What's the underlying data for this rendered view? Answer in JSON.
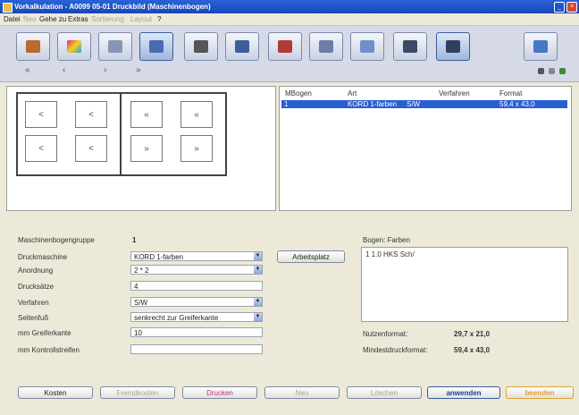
{
  "window": {
    "title": "Vorkalkulation - A0099 05-01 Druckbild (Maschinenbogen)"
  },
  "menu": {
    "items": [
      "Datei",
      "Neu",
      "Gehe zu",
      "Extras",
      "Sortierung",
      "Layout",
      "?"
    ]
  },
  "toolbar": {
    "nav": [
      "«",
      "‹",
      "›",
      "»"
    ]
  },
  "preview": {
    "cells": [
      "<",
      "<",
      "<",
      "<",
      "«",
      "«",
      "»",
      "»"
    ]
  },
  "grid": {
    "headers": [
      "MBogen",
      "Art",
      "Verfahren",
      "Format"
    ],
    "rows": [
      {
        "mbogen": "1",
        "art": "KORD 1-farben",
        "verfahren": "S/W",
        "format": "59,4 x 43,0"
      }
    ]
  },
  "form": {
    "maschinenbogengruppe_label": "Maschinenbogengruppe",
    "maschinenbogengruppe_value": "1",
    "druckmaschine_label": "Druckmaschine",
    "druckmaschine_value": "KORD 1-farben",
    "anordnung_label": "Anordnung",
    "anordnung_value": "2 * 2",
    "drucksaetze_label": "Drucksätze",
    "drucksaetze_value": "4",
    "verfahren_label": "Verfahren",
    "verfahren_value": "S/W",
    "seitenfuss_label": "Seitenfuß",
    "seitenfuss_value": "senkrecht zur Greiferkante",
    "greiferkante_label": "mm Greiferkante",
    "greiferkante_value": "10",
    "kontrollstreifen_label": "mm Kontrollstreifen",
    "kontrollstreifen_value": "",
    "arbeitsplatz_button": "Arbeitsplatz"
  },
  "right": {
    "bogen_farben_label": "Bogen: Farben",
    "farben_line": "1    1.0  HKS Sch/",
    "nutzenformat_label": "Nutzenformat:",
    "nutzenformat_value": "29,7 x 21,0",
    "mindestdruckformat_label": "Mindestdruckformat:",
    "mindestdruckformat_value": "59,4 x 43,0"
  },
  "buttons": {
    "kosten": "Kosten",
    "fremdkosten": "Fremdkosten",
    "drucken": "Drucken",
    "neu": "Neu",
    "loeschen": "Löschen",
    "anwenden": "anwenden",
    "beenden": "beenden"
  },
  "colors": {
    "title_bar": "#1e4fc2",
    "selection": "#2a5fd0",
    "drucken": "#c0308f",
    "anwenden": "#1b3f9a",
    "beenden": "#e0a030"
  }
}
